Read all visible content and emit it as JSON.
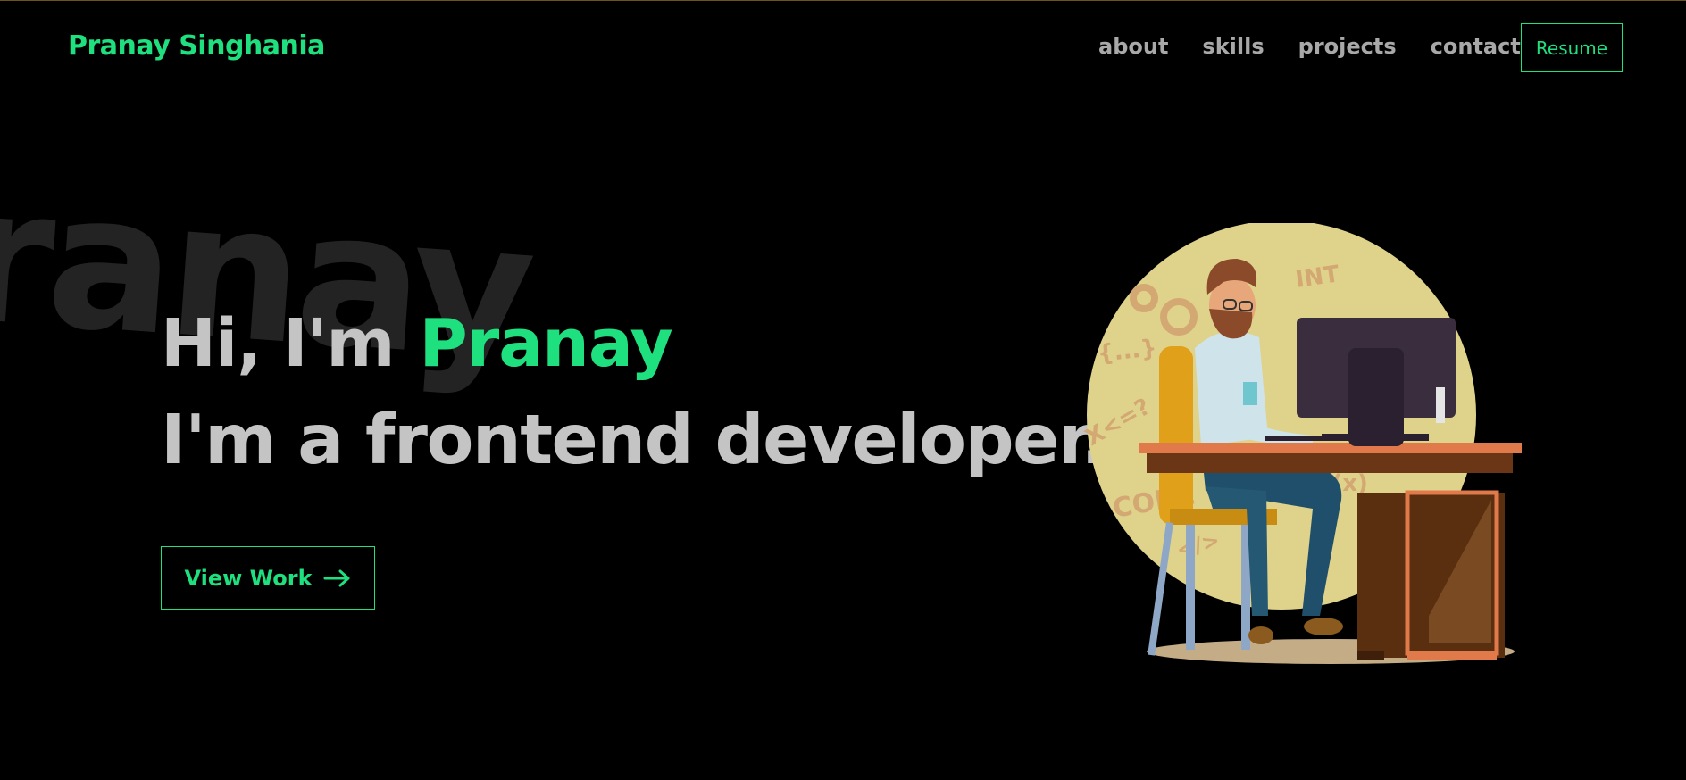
{
  "header": {
    "logo": "Pranay Singhania",
    "nav": [
      "about",
      "skills",
      "projects",
      "contact"
    ],
    "resume_label": "Resume"
  },
  "hero": {
    "background_word": "ranay",
    "greeting": "Hi, I'm",
    "name": "Pranay",
    "role": "I'm a frontend developer.",
    "cta_label": "View Work",
    "cta_icon": "arrow-right-icon"
  },
  "illustration": {
    "doodles": [
      "INT",
      "{...}",
      "X<=?",
      "CODE",
      "</>",
      "f(x)"
    ]
  },
  "colors": {
    "accent": "#1fe07f",
    "background": "#000000",
    "text": "#c4c4c4",
    "nav_text": "#a8a8a8",
    "background_word": "#232323"
  }
}
